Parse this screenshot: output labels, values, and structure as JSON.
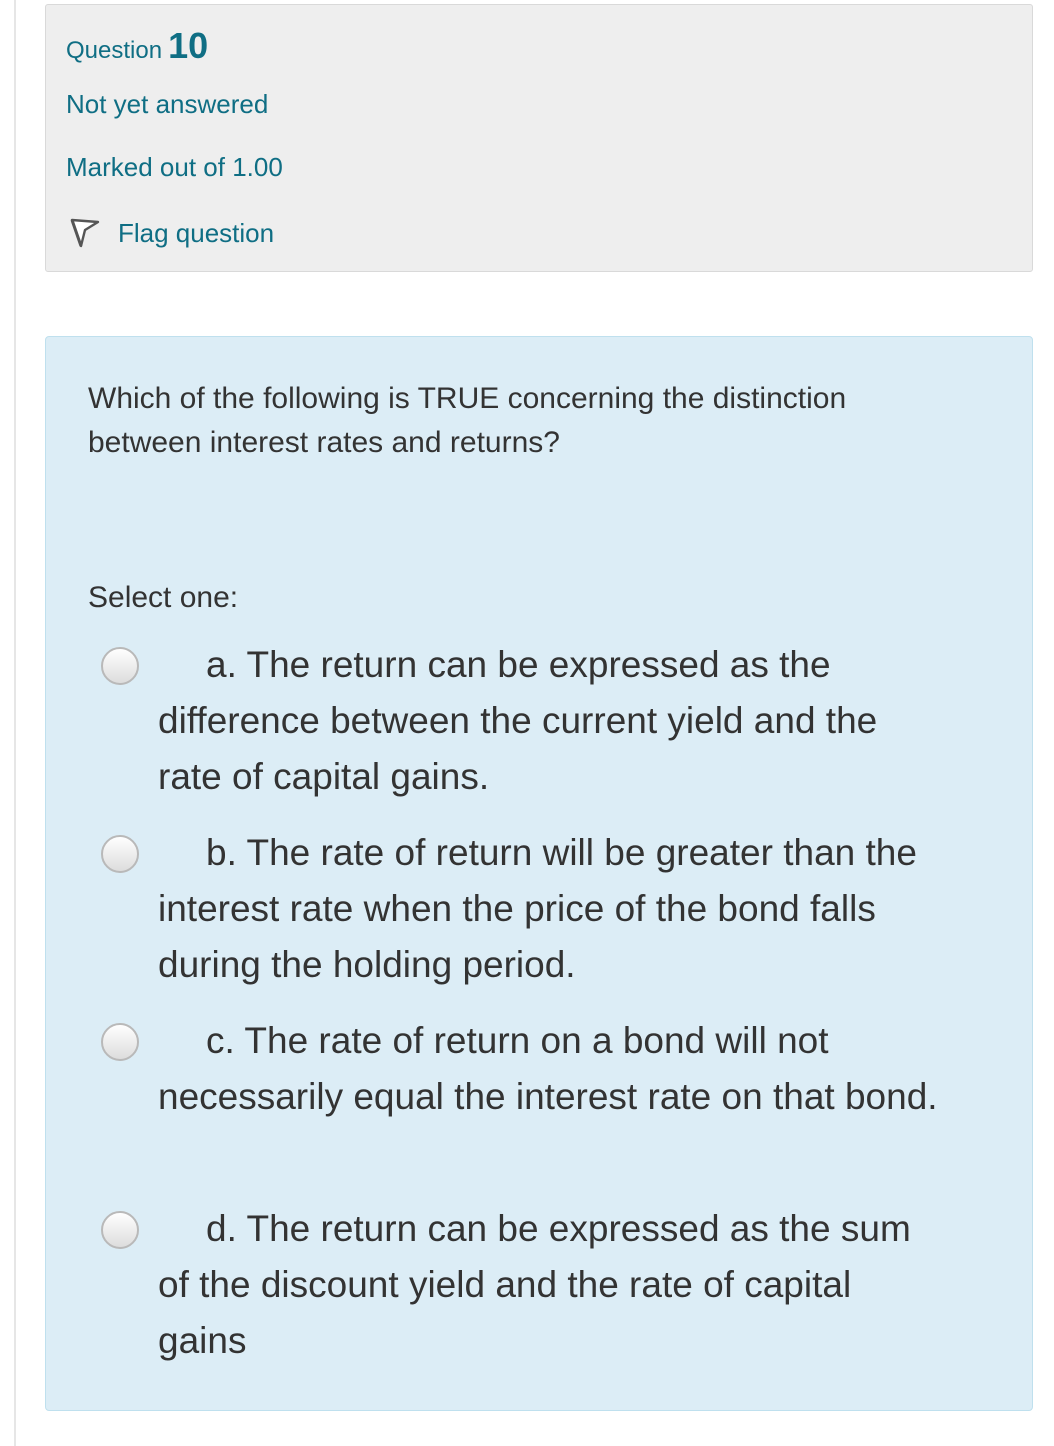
{
  "question": {
    "label": "Question",
    "number": "10",
    "state": "Not yet answered",
    "grade": "Marked out of 1.00",
    "flag_label": "Flag question"
  },
  "content": {
    "question_text": "Which of the following is TRUE concerning the distinction between interest rates and returns?",
    "prompt": "Select one:",
    "options": [
      {
        "text": "a. The return can be expressed as the difference between the current yield and the rate of capital gains.",
        "selected": false
      },
      {
        "text": "b. The rate of return will be greater than the interest rate when the price of the bond falls during the holding period.",
        "selected": false
      },
      {
        "text": "c. The rate of return on a bond will not necessarily equal the interest rate on that bond.",
        "selected": false
      },
      {
        "text": "d. The return can be expressed as the sum of the discount yield and the rate of capital gains",
        "selected": false
      }
    ]
  },
  "icons": {
    "flag": "flag-icon",
    "radio": "radio-button"
  },
  "colors": {
    "link": "#0f6e84",
    "info_bg": "#eeeeee",
    "content_bg": "#dcedf6",
    "text": "#333333"
  }
}
